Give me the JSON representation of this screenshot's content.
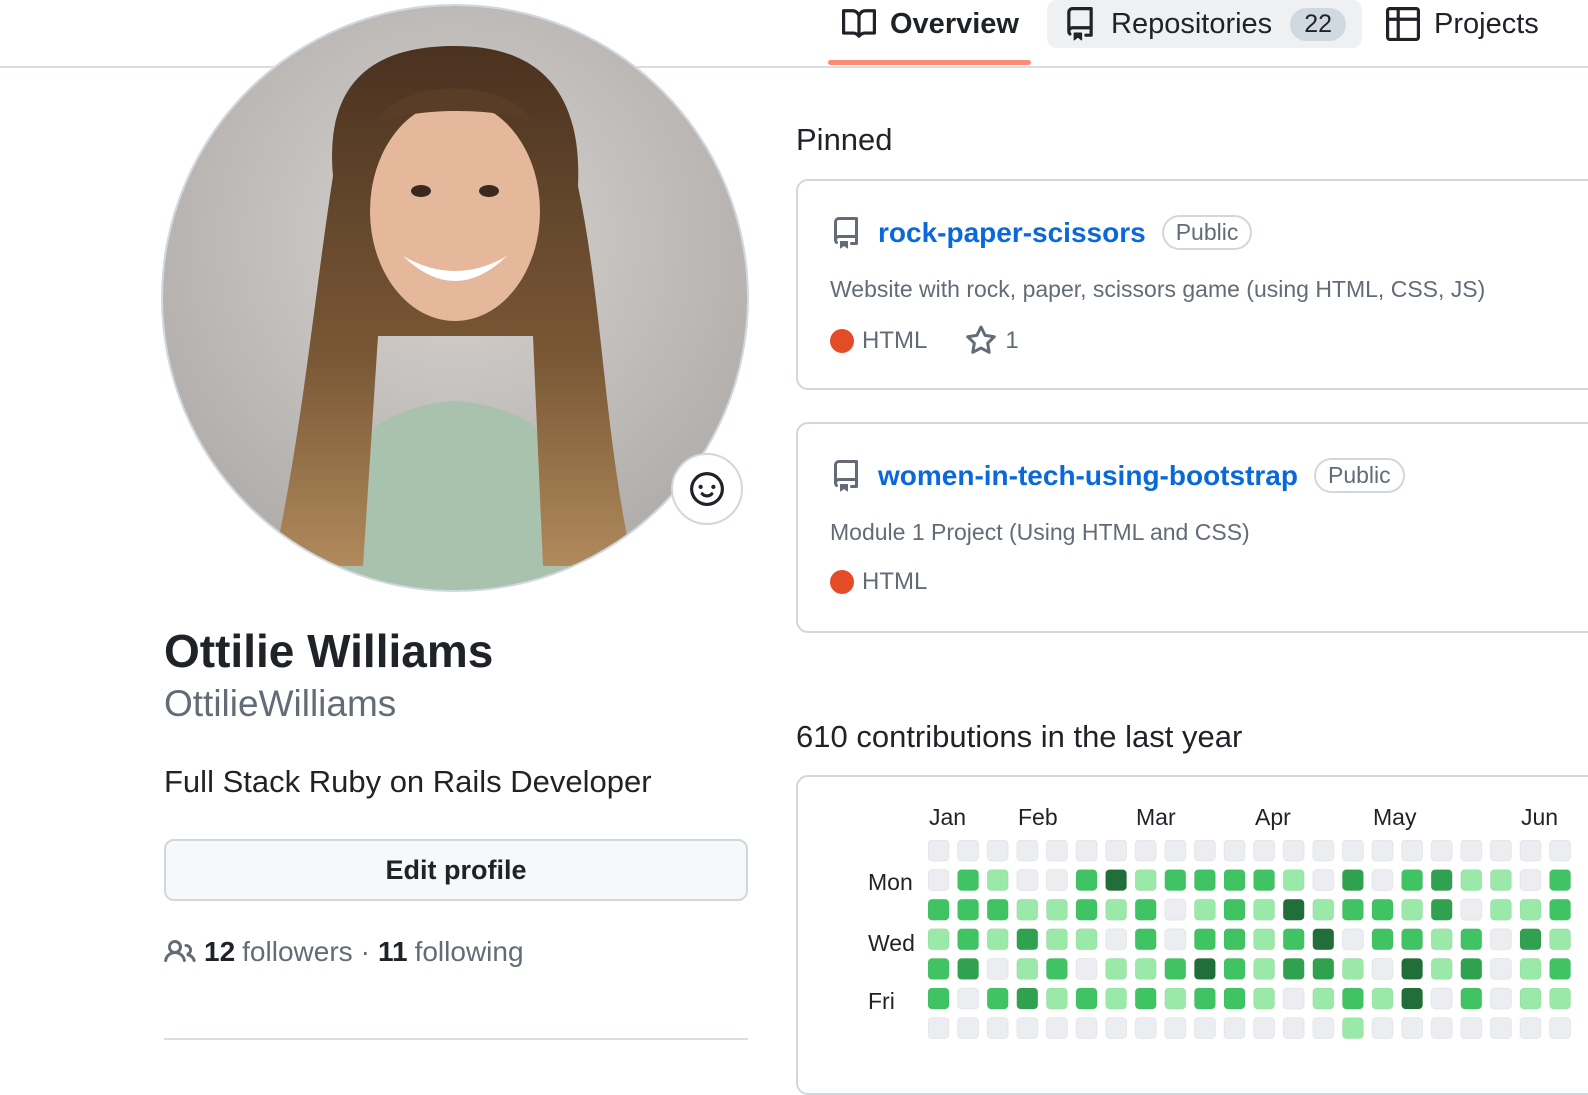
{
  "nav": {
    "tabs": [
      {
        "label": "Overview",
        "icon": "book-icon",
        "selected": true
      },
      {
        "label": "Repositories",
        "icon": "repo-icon",
        "count": "22"
      },
      {
        "label": "Projects",
        "icon": "project-table-icon"
      }
    ]
  },
  "profile": {
    "full_name": "Ottilie Williams",
    "username": "OttilieWilliams",
    "bio": "Full Stack Ruby on Rails Developer",
    "edit_profile_label": "Edit profile",
    "followers_count": "12",
    "followers_label": "followers",
    "separator": "·",
    "following_count": "11",
    "following_label": "following"
  },
  "pinned": {
    "title": "Pinned",
    "repos": [
      {
        "name": "rock-paper-scissors",
        "visibility": "Public",
        "description": "Website with rock, paper, scissors game (using HTML, CSS, JS)",
        "language": "HTML",
        "language_color": "#e34c26",
        "stars": "1"
      },
      {
        "name": "women-in-tech-using-bootstrap",
        "visibility": "Public",
        "description": "Module 1 Project (Using HTML and CSS)",
        "language": "HTML",
        "language_color": "#e34c26"
      }
    ]
  },
  "contributions": {
    "title": "610 contributions in the last year",
    "months": [
      "Jan",
      "Feb",
      "Mar",
      "Apr",
      "May",
      "Jun"
    ],
    "days": [
      "Mon",
      "Wed",
      "Fri"
    ],
    "level_colors": [
      "#ebedf0",
      "#9be9a8",
      "#40c463",
      "#30a14e",
      "#216e39"
    ],
    "levels": [
      [
        0,
        0,
        0,
        0,
        0,
        0,
        0,
        0,
        0,
        0,
        0,
        0,
        0,
        0,
        0,
        0,
        0,
        0,
        0,
        0,
        0,
        0
      ],
      [
        0,
        2,
        1,
        0,
        0,
        2,
        4,
        1,
        2,
        2,
        2,
        2,
        1,
        0,
        3,
        0,
        2,
        3,
        1,
        1,
        0,
        2
      ],
      [
        2,
        2,
        2,
        1,
        1,
        2,
        1,
        2,
        0,
        1,
        2,
        1,
        4,
        1,
        2,
        2,
        1,
        3,
        0,
        1,
        1,
        2
      ],
      [
        1,
        2,
        1,
        3,
        1,
        1,
        0,
        2,
        0,
        2,
        2,
        1,
        2,
        4,
        0,
        2,
        2,
        1,
        2,
        0,
        3,
        1
      ],
      [
        2,
        3,
        0,
        1,
        2,
        0,
        1,
        1,
        2,
        4,
        2,
        1,
        3,
        3,
        1,
        0,
        4,
        1,
        3,
        0,
        1,
        2
      ],
      [
        2,
        0,
        2,
        3,
        1,
        2,
        1,
        2,
        1,
        2,
        2,
        1,
        0,
        1,
        2,
        1,
        4,
        0,
        2,
        0,
        1,
        1
      ],
      [
        0,
        0,
        0,
        0,
        0,
        0,
        0,
        0,
        0,
        0,
        0,
        0,
        0,
        0,
        1,
        0,
        0,
        0,
        0,
        0,
        0,
        0
      ]
    ]
  }
}
